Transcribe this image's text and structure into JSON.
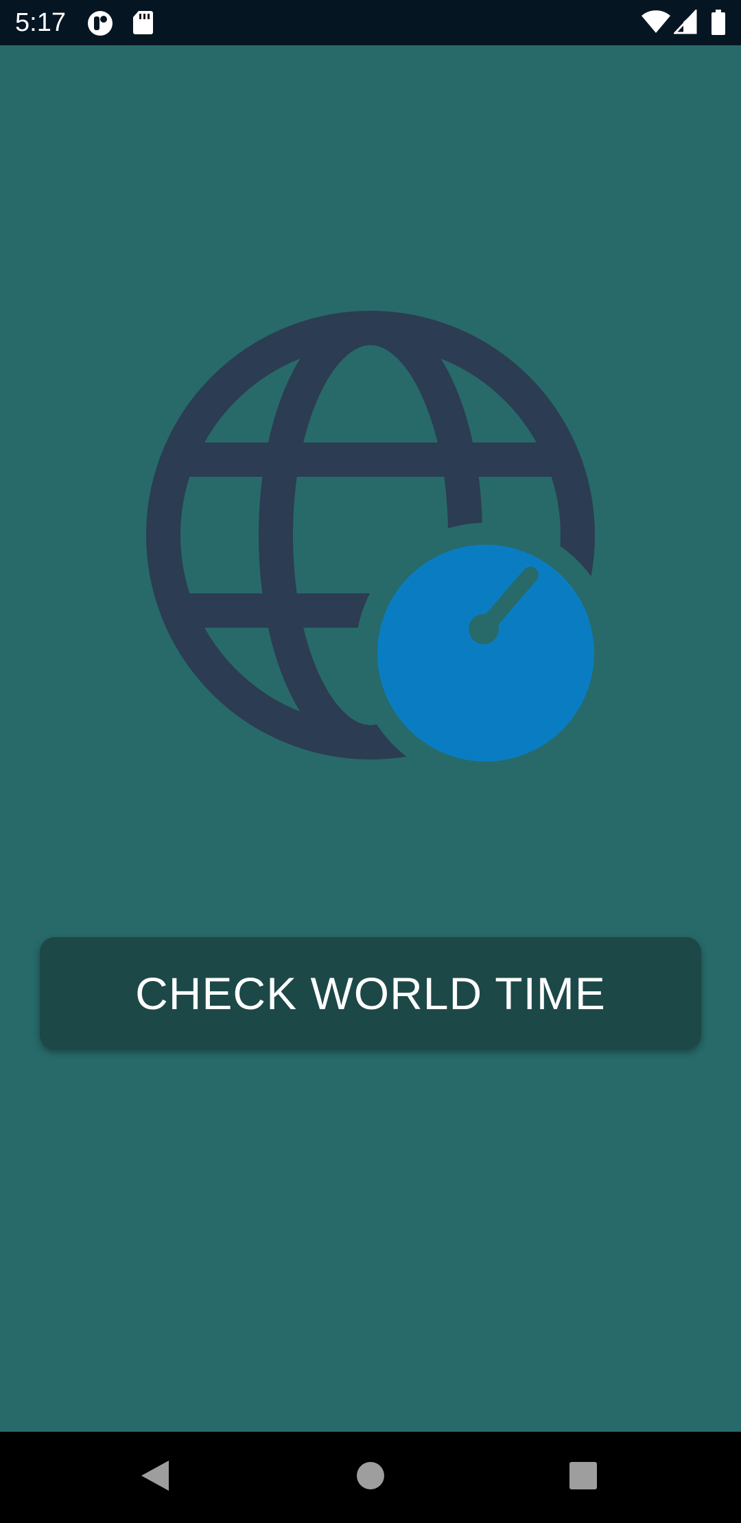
{
  "status_bar": {
    "time": "5:17",
    "left_icons": [
      "app-notification-icon",
      "sd-card-icon"
    ],
    "right_icons": [
      "wifi-icon",
      "cell-signal-icon",
      "battery-icon"
    ]
  },
  "hero": {
    "icon": "globe-stopwatch-icon",
    "colors": {
      "globe": "#2c3c52",
      "stopwatch": "#0a7dc2",
      "needle": "#276a69"
    }
  },
  "main": {
    "check_button_label": "CHECK WORLD TIME"
  },
  "nav_bar": {
    "buttons": [
      "back-icon",
      "home-icon",
      "recents-icon"
    ]
  },
  "colors": {
    "background": "#276a69",
    "status_bar": "#061522",
    "button_background": "#1d4848",
    "button_text": "#ffffff",
    "nav_bar": "#000000",
    "nav_icon": "#9e9e9e"
  }
}
